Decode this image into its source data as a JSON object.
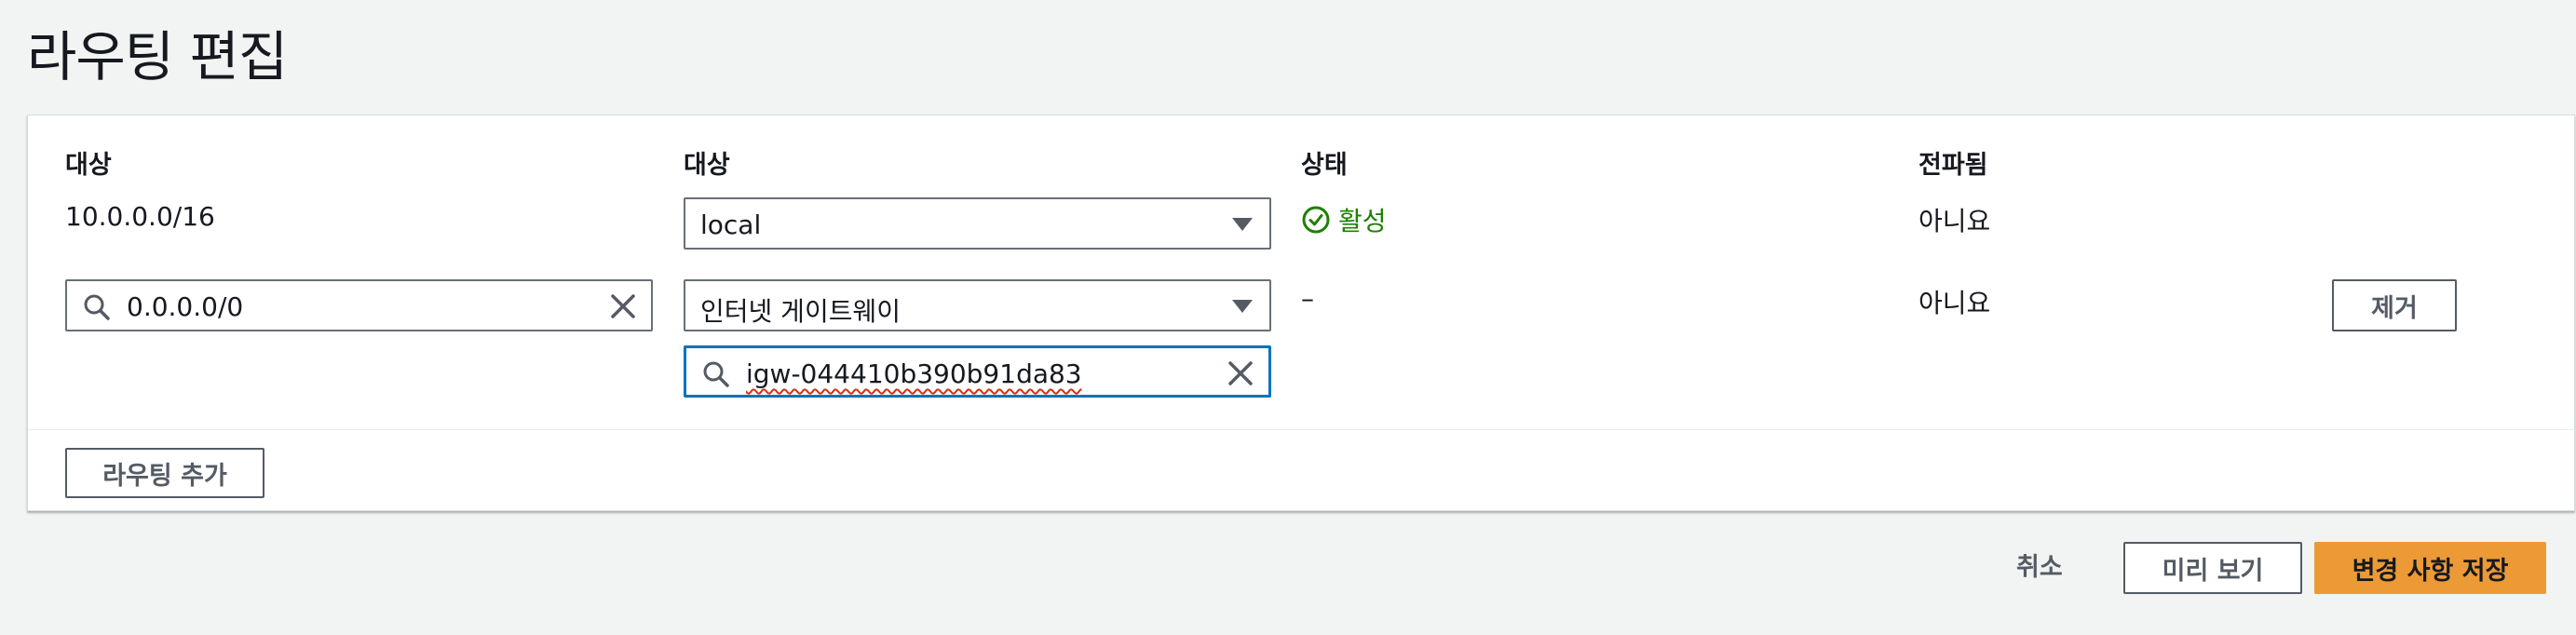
{
  "page": {
    "title": "라우팅 편집"
  },
  "table": {
    "headers": [
      "대상",
      "대상",
      "상태",
      "전파됨"
    ],
    "rows": [
      {
        "destination": "10.0.0.0/16",
        "target": "local",
        "status": "활성",
        "propagated": "아니요"
      },
      {
        "destination": "0.0.0.0/0",
        "target": "인터넷 게이트웨이",
        "target_search": "igw-044410b390b91da83",
        "status": "–",
        "propagated": "아니요",
        "remove_label": "제거"
      }
    ]
  },
  "add_route_label": "라우팅 추가",
  "footer": {
    "cancel_label": "취소",
    "preview_label": "미리 보기",
    "save_label": "변경 사항 저장"
  },
  "colors": {
    "primary": "#ec9a36",
    "focus": "#0073bb",
    "success": "#1d8102",
    "background": "#f2f3f3"
  },
  "icons": {
    "search": "search-icon",
    "clear": "clear-x-icon",
    "caret": "caret-down-icon",
    "status": "check-circle-icon"
  }
}
